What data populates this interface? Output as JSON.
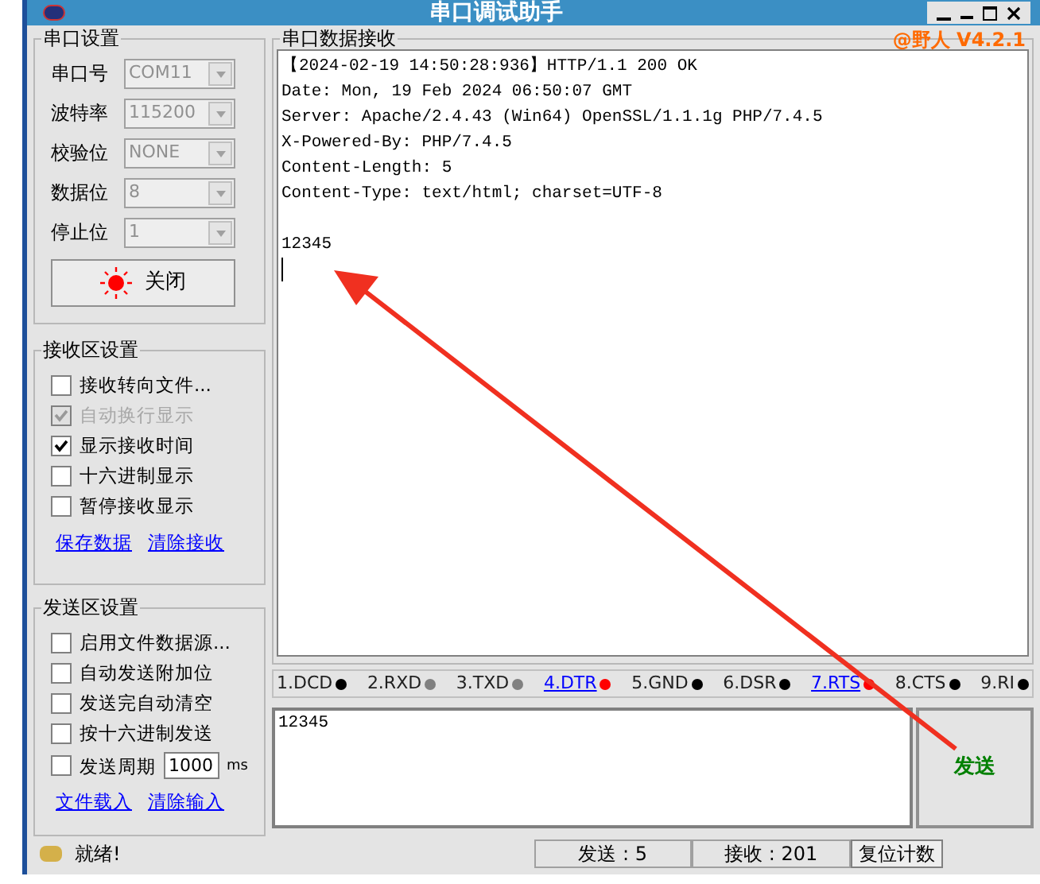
{
  "window": {
    "title": "串口调试助手"
  },
  "serial_settings": {
    "title": "串口设置",
    "fields": [
      {
        "label": "串口号",
        "value": "COM11"
      },
      {
        "label": "波特率",
        "value": "115200"
      },
      {
        "label": "校验位",
        "value": "NONE"
      },
      {
        "label": "数据位",
        "value": "8"
      },
      {
        "label": "停止位",
        "value": "1"
      }
    ],
    "open_button": {
      "label": "关闭",
      "on": true
    }
  },
  "receive_settings": {
    "title": "接收区设置",
    "options": [
      {
        "label": "接收转向文件...",
        "checked": false,
        "disabled": false
      },
      {
        "label": "自动换行显示",
        "checked": true,
        "disabled": true
      },
      {
        "label": "显示接收时间",
        "checked": true,
        "disabled": false
      },
      {
        "label": "十六进制显示",
        "checked": false,
        "disabled": false
      },
      {
        "label": "暂停接收显示",
        "checked": false,
        "disabled": false
      }
    ],
    "links": [
      "保存数据",
      "清除接收"
    ]
  },
  "send_settings": {
    "title": "发送区设置",
    "options": [
      {
        "label": "启用文件数据源...",
        "checked": false
      },
      {
        "label": "自动发送附加位",
        "checked": false
      },
      {
        "label": "发送完自动清空",
        "checked": false
      },
      {
        "label": "按十六进制发送",
        "checked": false
      }
    ],
    "period": {
      "label": "发送周期",
      "checked": false,
      "value": "1000",
      "unit": "ms"
    },
    "links": [
      "文件载入",
      "清除输入"
    ]
  },
  "receive_area": {
    "title": "串口数据接收",
    "version": "@野人 V4.2.1",
    "header_lines": [
      "【2024-02-19 14:50:28:936】HTTP/1.1 200 OK",
      "Date: Mon, 19 Feb 2024 06:50:07 GMT",
      "Server: Apache/2.4.43 (Win64) OpenSSL/1.1.1g PHP/7.4.5",
      "X-Powered-By: PHP/7.4.5",
      "Content-Length: 5",
      "Content-Type: text/html; charset=UTF-8"
    ],
    "body_lines": [
      "12345"
    ]
  },
  "pins": [
    {
      "label": "1.DCD",
      "link": false,
      "color": "#000000"
    },
    {
      "label": "2.RXD",
      "link": false,
      "color": "#808080"
    },
    {
      "label": "3.TXD",
      "link": false,
      "color": "#808080"
    },
    {
      "label": "4.DTR",
      "link": true,
      "color": "#ff0000"
    },
    {
      "label": "5.GND",
      "link": false,
      "color": "#000000"
    },
    {
      "label": "6.DSR",
      "link": false,
      "color": "#000000"
    },
    {
      "label": "7.RTS",
      "link": true,
      "color": "#ff0000"
    },
    {
      "label": "8.CTS",
      "link": false,
      "color": "#000000"
    },
    {
      "label": "9.RI",
      "link": false,
      "color": "#000000"
    }
  ],
  "send_area": {
    "value": "12345",
    "send_button": "发送"
  },
  "status_bar": {
    "status": "就绪!",
    "sent": "发送 : 5",
    "received": "接收 : 201",
    "reset_button": "复位计数"
  }
}
